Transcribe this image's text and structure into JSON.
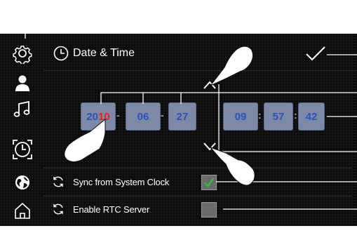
{
  "screen": {
    "title": "Date & Time",
    "sidebar": [
      {
        "icon": "settings-icon"
      },
      {
        "icon": "user-icon"
      },
      {
        "icon": "music-icon"
      },
      {
        "icon": "clock-icon"
      },
      {
        "icon": "globe-icon"
      },
      {
        "icon": "home-icon"
      }
    ],
    "date": {
      "year_prefix": "20",
      "year_suffix": "10",
      "month": "06",
      "day": "27",
      "separator": "-"
    },
    "time": {
      "hour": "09",
      "minute": "57",
      "second": "42",
      "separator": ":"
    },
    "options": [
      {
        "label": "Sync from System Clock",
        "checked": true
      },
      {
        "label": "Enable RTC Server",
        "checked": false
      }
    ],
    "colors": {
      "background": "#0c0c0c",
      "field": "#7c8aa7",
      "field_text": "#2f4fb8",
      "highlight": "#e0241b",
      "check": "#31c13a"
    }
  }
}
